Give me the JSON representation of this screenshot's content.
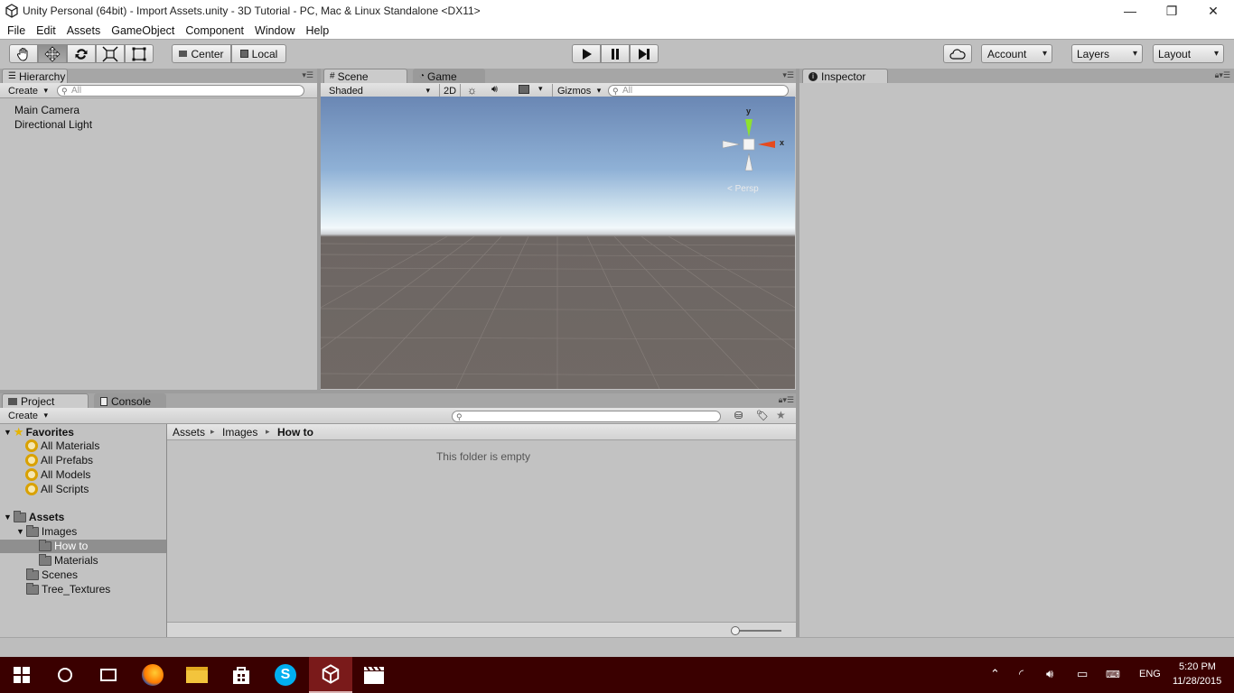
{
  "window": {
    "title": "Unity Personal (64bit) - Import Assets.unity - 3D Tutorial - PC, Mac & Linux Standalone <DX11>",
    "minimize": "—",
    "restore": "❐",
    "close": "✕"
  },
  "menu": [
    "File",
    "Edit",
    "Assets",
    "GameObject",
    "Component",
    "Window",
    "Help"
  ],
  "toolbar": {
    "center": "Center",
    "local": "Local",
    "account": "Account",
    "layers": "Layers",
    "layout": "Layout"
  },
  "hierarchy": {
    "tab": "Hierarchy",
    "create": "Create",
    "search_placeholder": "All",
    "items": [
      "Main Camera",
      "Directional Light"
    ]
  },
  "scene": {
    "tabs": [
      "Scene",
      "Game"
    ],
    "shading": "Shaded",
    "mode_2d": "2D",
    "gizmos": "Gizmos",
    "search_placeholder": "All",
    "gizmo_y": "y",
    "gizmo_x": "x",
    "persp": "Persp"
  },
  "inspector": {
    "tab": "Inspector"
  },
  "project": {
    "tabs": [
      "Project",
      "Console"
    ],
    "create": "Create",
    "favorites_label": "Favorites",
    "favorites": [
      "All Materials",
      "All Prefabs",
      "All Models",
      "All Scripts"
    ],
    "assets_label": "Assets",
    "tree": {
      "images": "Images",
      "how_to": "How to",
      "materials": "Materials",
      "scenes": "Scenes",
      "tree_textures": "Tree_Textures"
    },
    "breadcrumb": [
      "Assets",
      "Images",
      "How to"
    ],
    "empty_message": "This folder is empty"
  },
  "taskbar": {
    "lang": "ENG",
    "time": "5:20 PM",
    "date": "11/28/2015"
  },
  "colors": {
    "taskbar_bg": "#3a0000",
    "panel_bg": "#c2c2c2",
    "selected_row": "#8f8f8f"
  }
}
